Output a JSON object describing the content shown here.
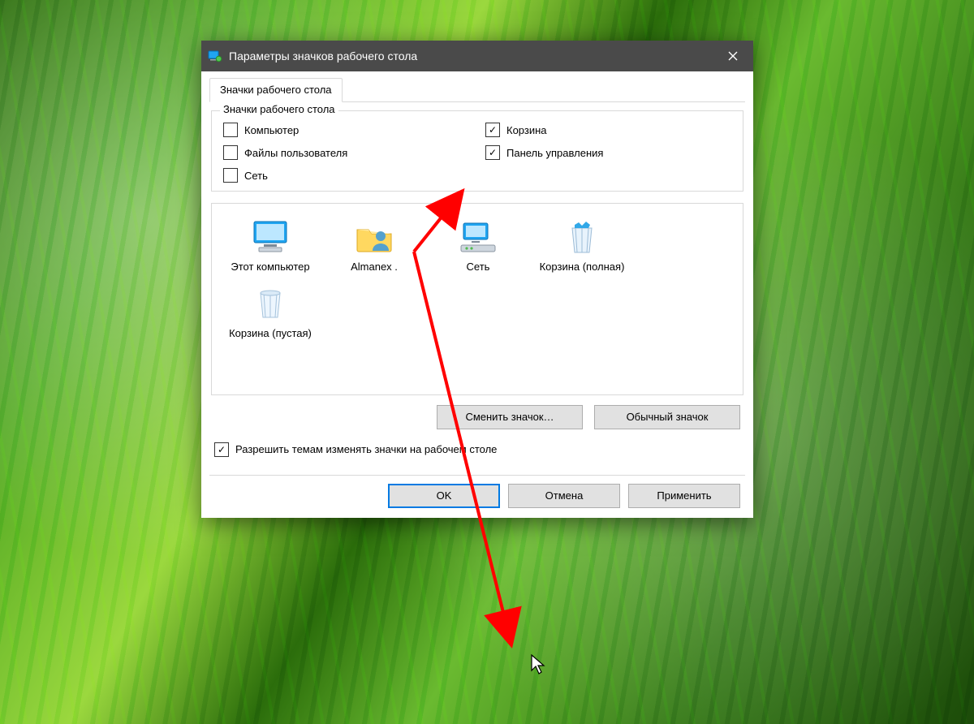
{
  "window": {
    "title": "Параметры значков рабочего стола",
    "tab_label": "Значки рабочего стола",
    "group_legend": "Значки рабочего стола"
  },
  "checkboxes": {
    "computer": {
      "label": "Компьютер",
      "checked": false
    },
    "recyclebin": {
      "label": "Корзина",
      "checked": true
    },
    "userfiles": {
      "label": "Файлы пользователя",
      "checked": false
    },
    "controlpanel": {
      "label": "Панель управления",
      "checked": true
    },
    "network": {
      "label": "Сеть",
      "checked": false
    }
  },
  "icons": {
    "this_pc": {
      "label": "Этот компьютер"
    },
    "user_folder": {
      "label": "Almanex ."
    },
    "network": {
      "label": "Сеть"
    },
    "bin_full": {
      "label": "Корзина (полная)"
    },
    "bin_empty": {
      "label": "Корзина (пустая)"
    }
  },
  "buttons": {
    "change_icon": "Сменить значок…",
    "default_icon": "Обычный значок",
    "ok": "OK",
    "cancel": "Отмена",
    "apply": "Применить"
  },
  "permit": {
    "label": "Разрешить темам изменять значки на рабочем столе",
    "checked": true
  },
  "colors": {
    "arrow": "#ff0000",
    "titlebar": "#4a4a4a",
    "accent": "#0078d7"
  }
}
